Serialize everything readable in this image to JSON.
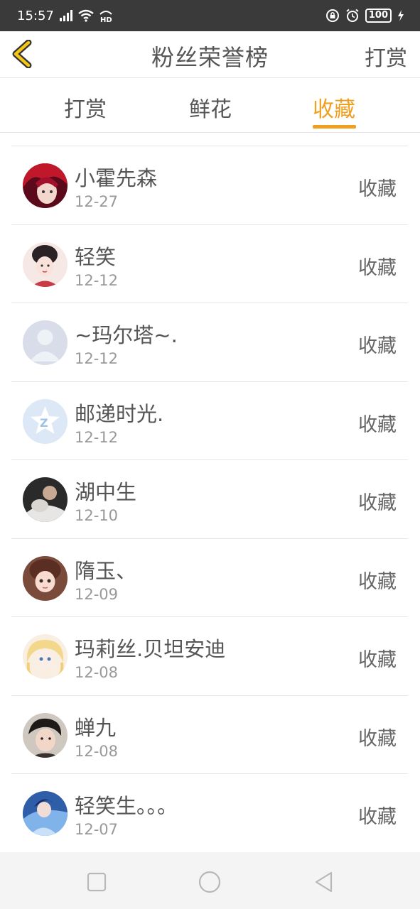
{
  "status_bar": {
    "time": "15:57",
    "battery": "100"
  },
  "header": {
    "title": "粉丝荣誉榜",
    "action_label": "打赏"
  },
  "tabs": [
    {
      "label": "打赏",
      "active": false
    },
    {
      "label": "鲜花",
      "active": false
    },
    {
      "label": "收藏",
      "active": true
    }
  ],
  "colors": {
    "accent": "#f0a020",
    "status_bar": "#3a3a3a"
  },
  "fans": [
    {
      "name": "小霍先森",
      "date": "12-27",
      "action": "收藏",
      "avatar": "red-hair-anime-avatar"
    },
    {
      "name": "轻笑",
      "date": "12-12",
      "action": "收藏",
      "avatar": "ancient-girl-avatar"
    },
    {
      "name": "~玛尔塔~.",
      "date": "12-12",
      "action": "收藏",
      "avatar": "default-person-avatar"
    },
    {
      "name": "邮递时光.",
      "date": "12-12",
      "action": "收藏",
      "avatar": "qzone-star-avatar"
    },
    {
      "name": "湖中生",
      "date": "12-10",
      "action": "收藏",
      "avatar": "photo-avatar"
    },
    {
      "name": "隋玉、",
      "date": "12-09",
      "action": "收藏",
      "avatar": "girl-photo-avatar"
    },
    {
      "name": "玛莉丝.贝坦安迪",
      "date": "12-08",
      "action": "收藏",
      "avatar": "blonde-anime-avatar"
    },
    {
      "name": "蝉九",
      "date": "12-08",
      "action": "收藏",
      "avatar": "boy-photo-avatar"
    },
    {
      "name": "轻笑生。。。",
      "date": "12-07",
      "action": "收藏",
      "avatar": "blue-fantasy-avatar"
    }
  ]
}
